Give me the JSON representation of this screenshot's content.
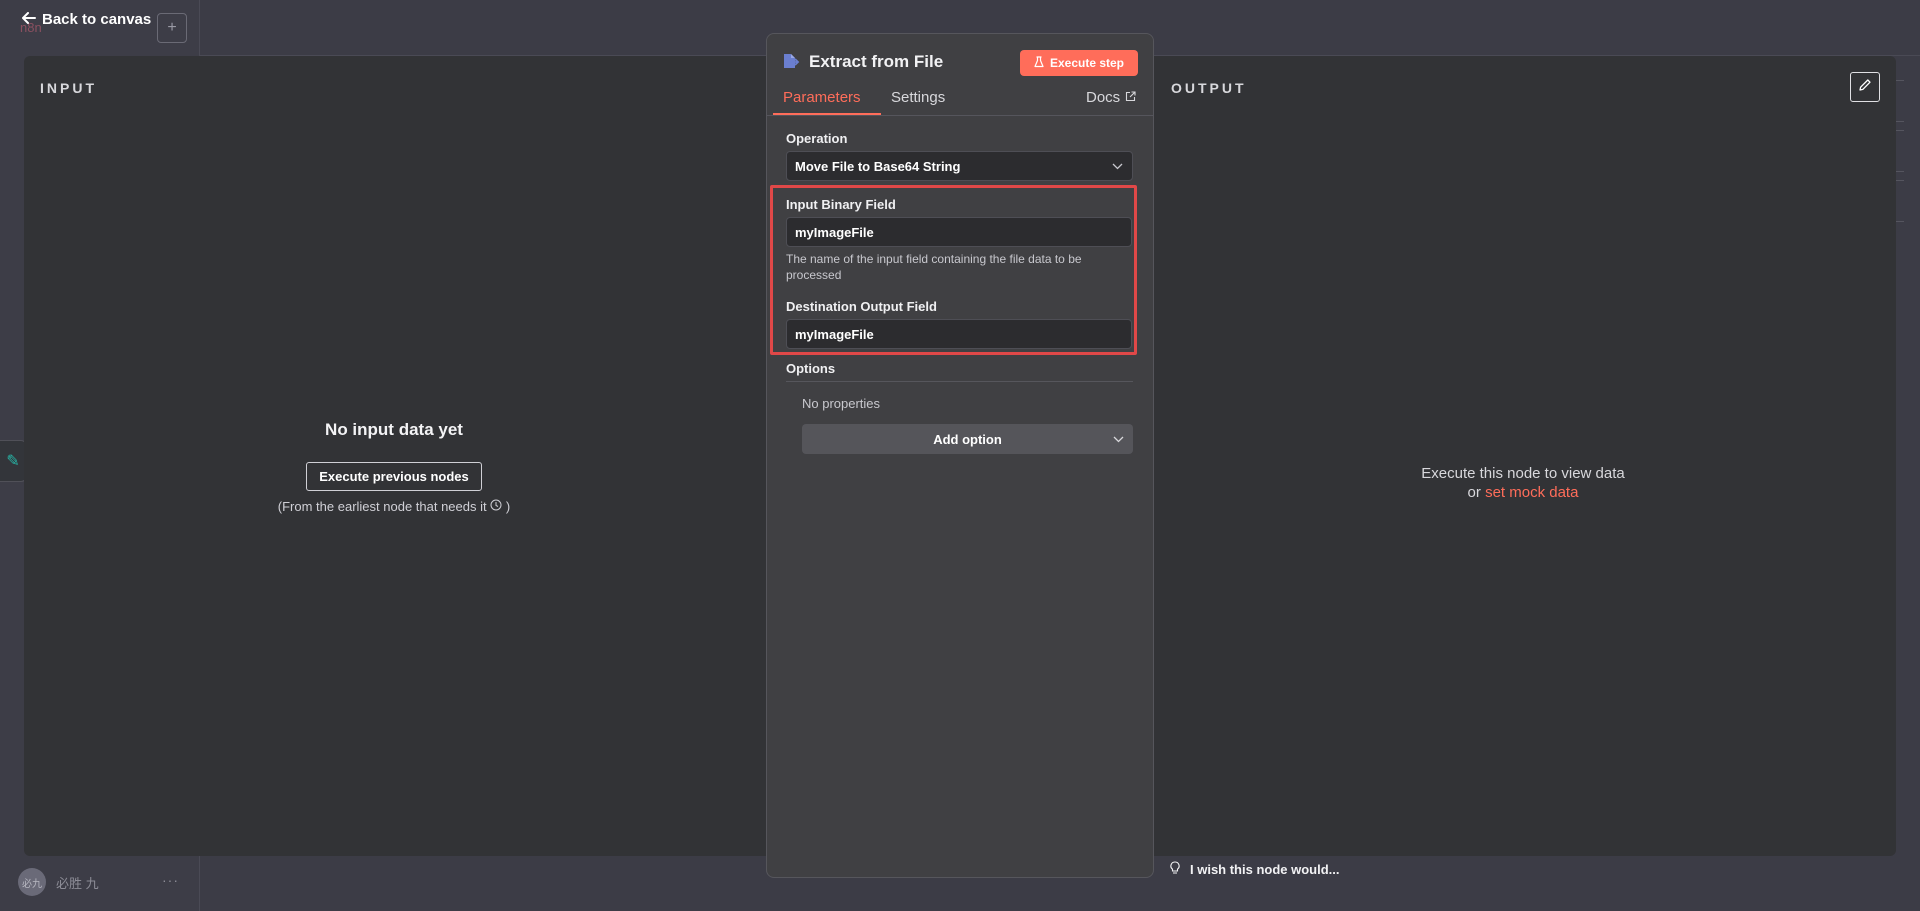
{
  "background": {
    "logo": "n8n",
    "user_avatar": "必九",
    "user_name": "必胜 九",
    "menu_dots": "···"
  },
  "nav": {
    "back_label": "Back to canvas"
  },
  "input_panel": {
    "title": "INPUT",
    "empty_heading": "No input data yet",
    "execute_previous_label": "Execute previous nodes",
    "earliest_hint": "(From the earliest node that needs it",
    "earliest_hint_end": ")"
  },
  "node": {
    "title": "Extract from File",
    "execute_step_label": "Execute step",
    "tabs": {
      "parameters": "Parameters",
      "settings": "Settings",
      "docs": "Docs"
    },
    "operation": {
      "label": "Operation",
      "value": "Move File to Base64 String"
    },
    "input_binary_field": {
      "label": "Input Binary Field",
      "value": "myImageFile",
      "hint": "The name of the input field containing the file data to be processed"
    },
    "destination_output_field": {
      "label": "Destination Output Field",
      "value": "myImageFile"
    },
    "options": {
      "label": "Options",
      "empty": "No properties",
      "add_label": "Add option"
    },
    "wish_label": "I wish this node would..."
  },
  "output_panel": {
    "title": "OUTPUT",
    "message_line1": "Execute this node to view data",
    "message_or": "or",
    "mock_link": "set mock data"
  },
  "colors": {
    "accent": "#ff6d5a",
    "highlight": "#e04848",
    "panel_bg": "#323336",
    "node_panel_bg": "#404043"
  }
}
